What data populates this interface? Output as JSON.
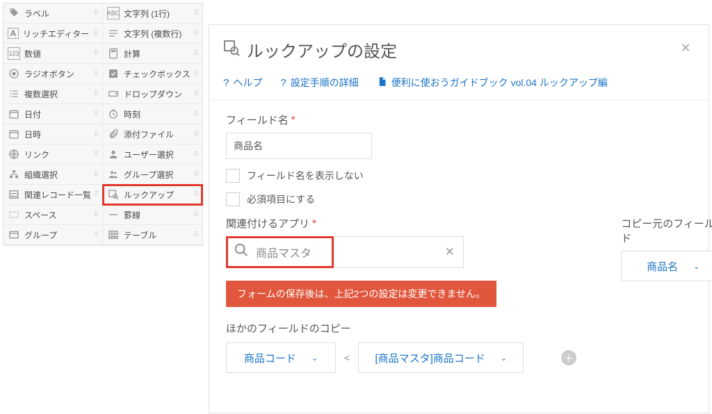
{
  "palette": {
    "items": [
      {
        "left": {
          "icon": "tag",
          "label": "ラベル"
        },
        "right": {
          "icon": "abc",
          "label": "文字列 (1行)"
        }
      },
      {
        "left": {
          "icon": "A",
          "label": "リッチエディター"
        },
        "right": {
          "icon": "lines",
          "label": "文字列 (複数行)"
        }
      },
      {
        "left": {
          "icon": "123",
          "label": "数値"
        },
        "right": {
          "icon": "calc",
          "label": "計算"
        }
      },
      {
        "left": {
          "icon": "radio",
          "label": "ラジオボタン"
        },
        "right": {
          "icon": "check",
          "label": "チェックボックス"
        }
      },
      {
        "left": {
          "icon": "multi",
          "label": "複数選択"
        },
        "right": {
          "icon": "drop",
          "label": "ドロップダウン"
        }
      },
      {
        "left": {
          "icon": "cal",
          "label": "日付"
        },
        "right": {
          "icon": "clock",
          "label": "時刻"
        }
      },
      {
        "left": {
          "icon": "cal",
          "label": "日時"
        },
        "right": {
          "icon": "clip",
          "label": "添付ファイル"
        }
      },
      {
        "left": {
          "icon": "globe",
          "label": "リンク"
        },
        "right": {
          "icon": "user",
          "label": "ユーザー選択"
        }
      },
      {
        "left": {
          "icon": "org",
          "label": "組織選択"
        },
        "right": {
          "icon": "group",
          "label": "グループ選択"
        }
      },
      {
        "left": {
          "icon": "list",
          "label": "関連レコード一覧"
        },
        "right": {
          "icon": "lookup",
          "label": "ルックアップ",
          "highlighted": true
        }
      },
      {
        "left": {
          "icon": "space",
          "label": "スペース"
        },
        "right": {
          "icon": "divider",
          "label": "罫線"
        }
      },
      {
        "left": {
          "icon": "groupf",
          "label": "グループ"
        },
        "right": {
          "icon": "table",
          "label": "テーブル"
        }
      }
    ]
  },
  "panel": {
    "title": "ルックアップの設定",
    "help": {
      "help": "ヘルプ",
      "detail": "設定手順の詳細",
      "guide": "便利に使おうガイドブック vol.04 ルックアップ編"
    },
    "fieldName": {
      "label": "フィールド名",
      "value": "商品名"
    },
    "checks": {
      "hideLabel": "フィールド名を表示しない",
      "required": "必須項目にする"
    },
    "relApp": {
      "label": "関連付けるアプリ",
      "value": "商品マスタ"
    },
    "srcField": {
      "label": "コピー元のフィールド",
      "selected": "商品名"
    },
    "warning": "フォームの保存後は、上記2つの設定は変更できません。",
    "otherCopy": {
      "label": "ほかのフィールドのコピー",
      "left": "商品コード",
      "right": "[商品マスタ]商品コード"
    }
  }
}
